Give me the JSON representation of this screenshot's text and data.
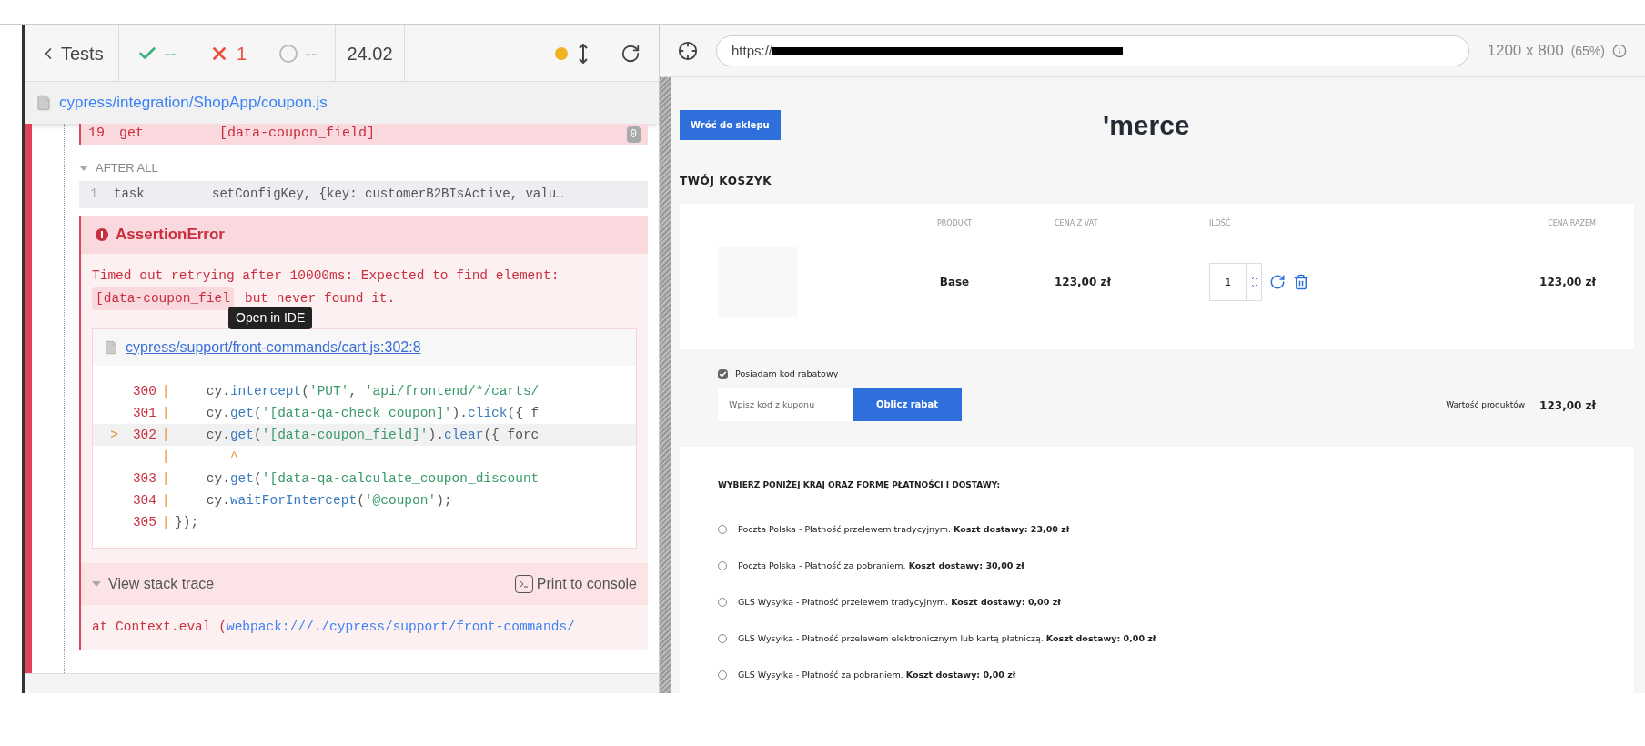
{
  "runner": {
    "back_label": "Tests",
    "passed": "--",
    "failed": "1",
    "pending": "--",
    "duration": "24.02",
    "spec_path": "cypress/integration/ShopApp/coupon.js"
  },
  "command_log": {
    "failed_command": {
      "number": "19",
      "name": "get",
      "message": "[data-coupon_field]",
      "count": "0"
    },
    "hook": {
      "title": "AFTER ALL",
      "expanded": true,
      "commands": [
        {
          "number": "1",
          "name": "task",
          "message": "setConfigKey, {key: customerB2BIsActive, valu…"
        }
      ]
    }
  },
  "error": {
    "title": "AssertionError",
    "message_start": "Timed out retrying after 10000ms: Expected to find element:",
    "message_code": "[data-coupon_fiel",
    "message_end": "but never found it.",
    "tooltip": "Open in IDE",
    "file_link": "cypress/support/front-commands/cart.js:302:8",
    "code_lines": [
      {
        "number": "300",
        "gutter": "|",
        "current": false,
        "tokens": [
          {
            "kind": "plain",
            "text": "    cy."
          },
          {
            "kind": "fn",
            "text": "intercept"
          },
          {
            "kind": "plain",
            "text": "("
          },
          {
            "kind": "str",
            "text": "'PUT'"
          },
          {
            "kind": "plain",
            "text": ", "
          },
          {
            "kind": "str",
            "text": "'api/frontend/*/carts/"
          }
        ]
      },
      {
        "number": "301",
        "gutter": "|",
        "current": false,
        "tokens": [
          {
            "kind": "plain",
            "text": "    cy."
          },
          {
            "kind": "fn",
            "text": "get"
          },
          {
            "kind": "plain",
            "text": "("
          },
          {
            "kind": "str",
            "text": "'[data-qa-check_coupon]'"
          },
          {
            "kind": "plain",
            "text": ")."
          },
          {
            "kind": "fn",
            "text": "click"
          },
          {
            "kind": "plain",
            "text": "({ f"
          }
        ]
      },
      {
        "number": "302",
        "marker": ">",
        "gutter": "|",
        "current": true,
        "tokens": [
          {
            "kind": "plain",
            "text": "    cy."
          },
          {
            "kind": "fn",
            "text": "get"
          },
          {
            "kind": "plain",
            "text": "("
          },
          {
            "kind": "str",
            "text": "'[data-coupon_field]'"
          },
          {
            "kind": "plain",
            "text": ")."
          },
          {
            "kind": "fn",
            "text": "clear"
          },
          {
            "kind": "plain",
            "text": "({ forc"
          }
        ]
      },
      {
        "gutter": "|",
        "current": false,
        "tokens": [
          {
            "kind": "caret",
            "text": "       ^"
          }
        ]
      },
      {
        "number": "303",
        "gutter": "|",
        "current": false,
        "tokens": [
          {
            "kind": "plain",
            "text": "    cy."
          },
          {
            "kind": "fn",
            "text": "get"
          },
          {
            "kind": "plain",
            "text": "("
          },
          {
            "kind": "str",
            "text": "'[data-qa-calculate_coupon_discount"
          }
        ]
      },
      {
        "number": "304",
        "gutter": "|",
        "current": false,
        "tokens": [
          {
            "kind": "plain",
            "text": "    cy."
          },
          {
            "kind": "fn",
            "text": "waitForIntercept"
          },
          {
            "kind": "plain",
            "text": "("
          },
          {
            "kind": "str",
            "text": "'@coupon'"
          },
          {
            "kind": "plain",
            "text": ");"
          }
        ]
      },
      {
        "number": "305",
        "gutter": "|",
        "current": false,
        "tokens": [
          {
            "kind": "plain",
            "text": "});"
          }
        ]
      }
    ],
    "stack_trace": {
      "label": "View stack trace",
      "expanded": true
    },
    "print_button": "Print to console",
    "stack_prefix": "at Context.eval (",
    "stack_link": "webpack:///./cypress/support/front-commands/"
  },
  "preview": {
    "url": "https://",
    "viewport": "1200 x 800",
    "scale": "(65%)",
    "back_button": "Wróć do sklepu",
    "logo": "'merce",
    "cart_title": "TWÓJ KOSZYK",
    "columns": [
      "PRODUKT",
      "CENA Z VAT",
      "ILOŚĆ",
      "CENA RAZEM"
    ],
    "items": [
      {
        "name": "Base",
        "price": "123,00 zł",
        "quantity": "1",
        "total": "123,00 zł"
      }
    ],
    "coupon": {
      "label": "Posiadam kod rabatowy",
      "checked": true,
      "placeholder": "Wpisz kod z kuponu",
      "button": "Oblicz rabat"
    },
    "summary": {
      "label": "Wartość produktów",
      "value": "123,00 zł"
    },
    "shipping": {
      "title": "WYBIERZ PONIŻEJ KRAJ ORAZ FORMĘ PŁATNOŚCI I DOSTAWY:",
      "options": [
        {
          "text": "Poczta Polska - Płatność przelewem tradycyjnym. **Koszt dostawy: 23,00 zł**",
          "selected": false
        },
        {
          "text": "Poczta Polska - Płatność za pobraniem. **Koszt dostawy: 30,00 zł**",
          "selected": false
        },
        {
          "text": "GLS Wysyłka - Płatność przelewem tradycyjnym. **Koszt dostawy: 0,00 zł**",
          "selected": false
        },
        {
          "text": "GLS Wysyłka - Płatność przelewem elektronicznym lub kartą płatniczą. **Koszt dostawy: 0,00 zł**",
          "selected": false
        },
        {
          "text": "GLS Wysyłka - Płatność za pobraniem. **Koszt dostawy: 0,00 zł**",
          "selected": false
        }
      ]
    }
  }
}
